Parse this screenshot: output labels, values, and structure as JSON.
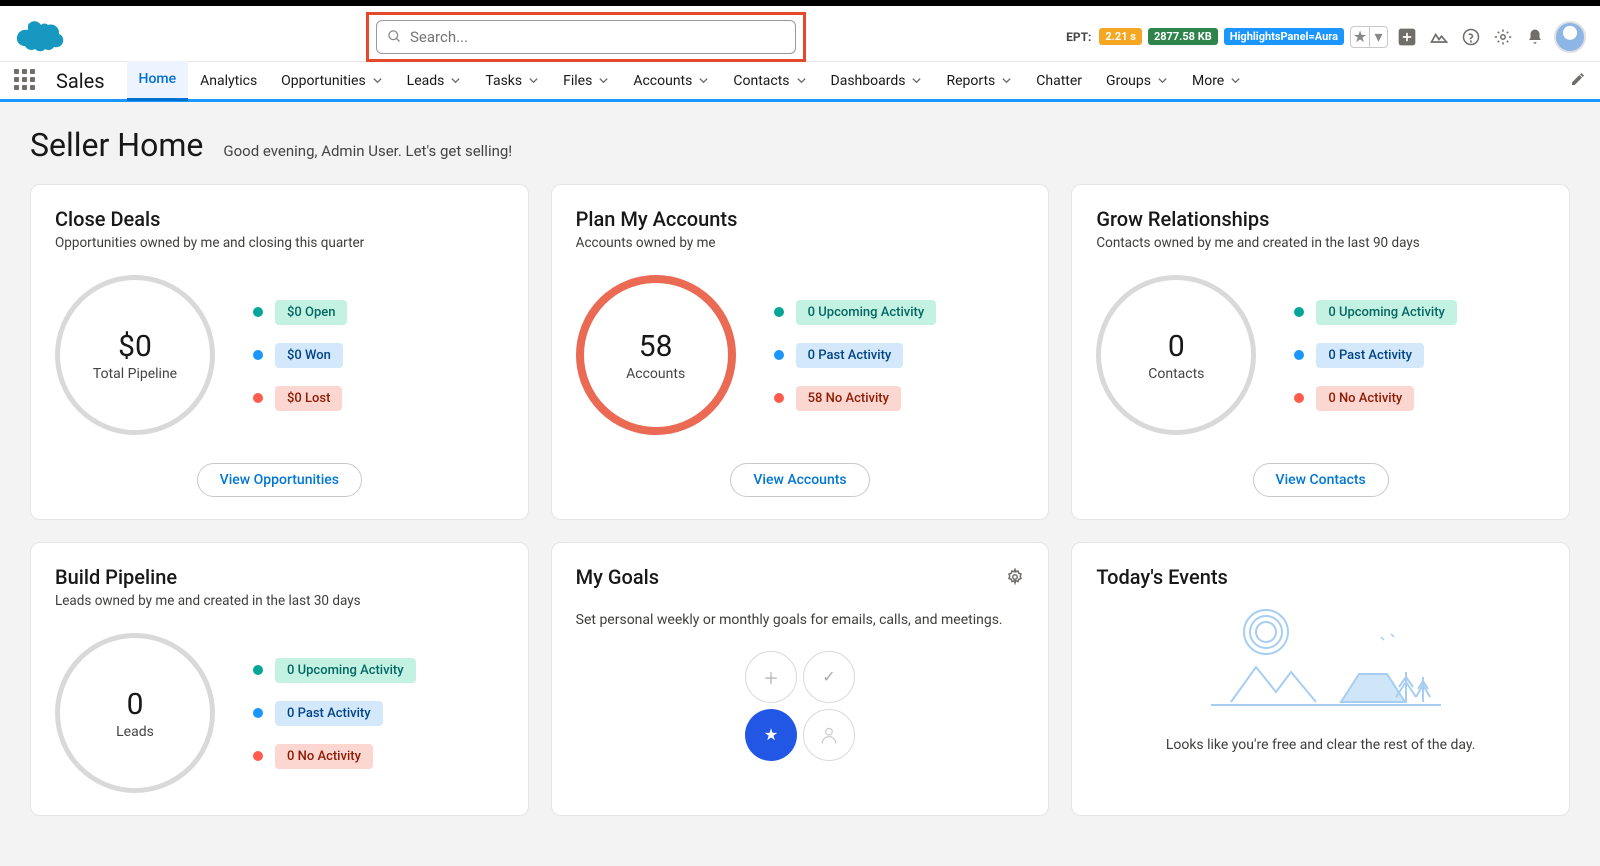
{
  "header": {
    "search_placeholder": "Search...",
    "ept_label": "EPT:",
    "ept_time": "2.21 s",
    "ept_size": "2877.58 KB",
    "ept_mode": "HighlightsPanel=Aura"
  },
  "nav": {
    "app_name": "Sales",
    "items": [
      "Home",
      "Analytics",
      "Opportunities",
      "Leads",
      "Tasks",
      "Files",
      "Accounts",
      "Contacts",
      "Dashboards",
      "Reports",
      "Chatter",
      "Groups",
      "More"
    ],
    "active": "Home"
  },
  "page": {
    "title": "Seller Home",
    "subtitle": "Good evening, Admin User. Let's get selling!"
  },
  "cards": {
    "close_deals": {
      "title": "Close Deals",
      "subtitle": "Opportunities owned by me and closing this quarter",
      "ring_value": "$0",
      "ring_label": "Total Pipeline",
      "legend": [
        {
          "color": "teal",
          "label": "$0 Open"
        },
        {
          "color": "blue",
          "label": "$0 Won"
        },
        {
          "color": "red",
          "label": "$0 Lost"
        }
      ],
      "action": "View Opportunities"
    },
    "plan_accounts": {
      "title": "Plan My Accounts",
      "subtitle": "Accounts owned by me",
      "ring_value": "58",
      "ring_label": "Accounts",
      "legend": [
        {
          "color": "teal",
          "label": "0 Upcoming Activity"
        },
        {
          "color": "blue",
          "label": "0 Past Activity"
        },
        {
          "color": "red",
          "label": "58 No Activity"
        }
      ],
      "action": "View Accounts"
    },
    "grow_relationships": {
      "title": "Grow Relationships",
      "subtitle": "Contacts owned by me and created in the last 90 days",
      "ring_value": "0",
      "ring_label": "Contacts",
      "legend": [
        {
          "color": "teal",
          "label": "0 Upcoming Activity"
        },
        {
          "color": "blue",
          "label": "0 Past Activity"
        },
        {
          "color": "red",
          "label": "0 No Activity"
        }
      ],
      "action": "View Contacts"
    },
    "build_pipeline": {
      "title": "Build Pipeline",
      "subtitle": "Leads owned by me and created in the last 30 days",
      "ring_value": "0",
      "ring_label": "Leads",
      "legend": [
        {
          "color": "teal",
          "label": "0 Upcoming Activity"
        },
        {
          "color": "blue",
          "label": "0 Past Activity"
        },
        {
          "color": "red",
          "label": "0 No Activity"
        }
      ]
    },
    "my_goals": {
      "title": "My Goals",
      "text": "Set personal weekly or monthly goals for emails, calls, and meetings."
    },
    "todays_events": {
      "title": "Today's Events",
      "text": "Looks like you're free and clear the rest of the day."
    }
  }
}
